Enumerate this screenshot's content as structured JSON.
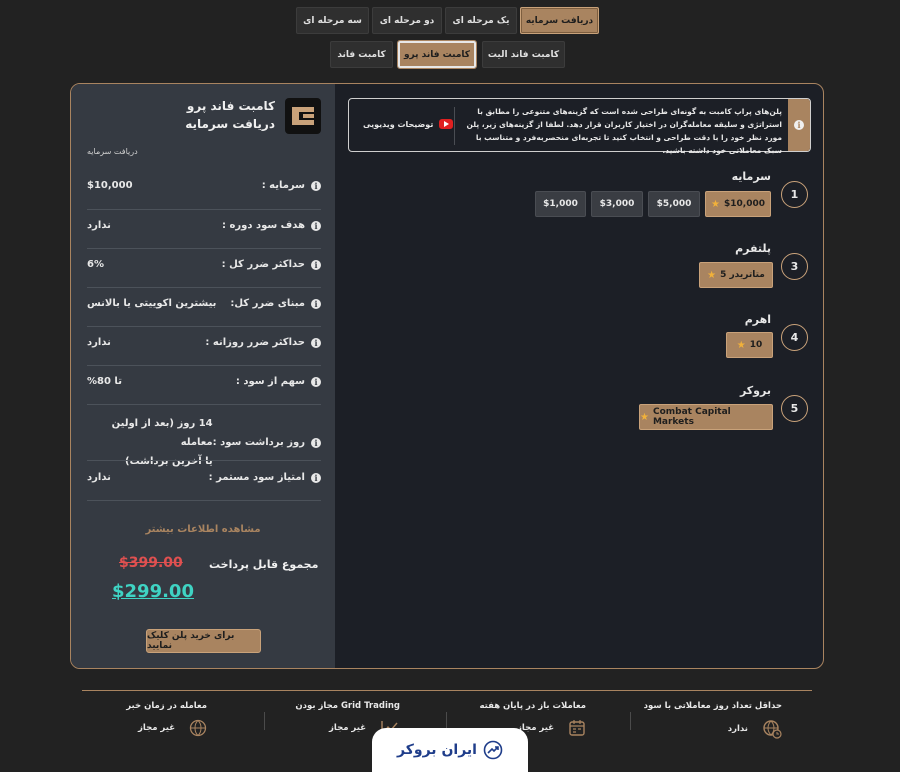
{
  "tabs_row1": [
    "دریافت سرمایه",
    "یک مرحله ای",
    "دو مرحله ای",
    "سه مرحله ای"
  ],
  "tabs_row2": [
    "کامبت فاند الیت",
    "کامبت فاند پرو",
    "کامبت فاند"
  ],
  "summary": {
    "plan_name": "کامبت فاند پرو",
    "plan_subtitle": "دریافت سرمایه",
    "breadcrumb": "دریافت سرمایه",
    "rows": [
      {
        "label": "سرمایه :",
        "value": "$10,000"
      },
      {
        "label": "هدف سود دوره :",
        "value": "ندارد"
      },
      {
        "label": "حداکثر ضرر کل :",
        "value": "6%"
      },
      {
        "label": "مبنای ضرر کل:",
        "value": "بیشترین اکوییتی یا بالانس"
      },
      {
        "label": "حداکثر ضرر روزانه :",
        "value": "ندارد"
      },
      {
        "label": "سهم از سود :",
        "value": "تا 80%"
      },
      {
        "label": "روز برداشت سود :",
        "value_line1": "14 روز (بعد از اولین معامله",
        "value_line2": "یا آخرین برداشت)"
      },
      {
        "label": "امتیاز سود مستمر :",
        "value": "ندارد"
      }
    ],
    "more_info": "مشاهده اطلاعات بیشتر",
    "total_label": "مجموع قابل پرداخت",
    "old_price": "$399.00",
    "new_price": "$299.00",
    "buy_button": "برای خرید پلن کلیک نمایید"
  },
  "notice": {
    "text": "پلن‌های پراپ کامبت به گونه‌ای طراحی شده است که گزینه‌های متنوعی را مطابق با استراتژی و سلیقه معامله‌گران در اختیار کاربران قرار دهد. لطفا از گزینه‌های زیر، پلن مورد نظر خود را با دقت طراحی و انتخاب کنید تا تجربه‌ای منحصربه‌فرد و متناسب با سبک معاملاتی خود داشته باشید.",
    "video_button": "توضیحات ویدیویی"
  },
  "steps": [
    {
      "number": "1",
      "title": "سرمایه",
      "options": [
        "$10,000",
        "$5,000",
        "$3,000",
        "$1,000"
      ],
      "selected": "$10,000"
    },
    {
      "number": "3",
      "title": "پلتفرم",
      "options": [
        "متاتریدر 5"
      ],
      "selected": "متاتریدر 5"
    },
    {
      "number": "4",
      "title": "اهرم",
      "options": [
        "10"
      ],
      "selected": "10"
    },
    {
      "number": "5",
      "title": "بروکر",
      "options": [
        "Combat Capital Markets"
      ],
      "selected": "Combat Capital Markets"
    }
  ],
  "bottom": [
    {
      "title": "حداقل تعداد روز معاملاتی با سود",
      "value": "ندارد",
      "icon": "clock-globe-icon"
    },
    {
      "title": "معاملات باز در پایان هفته",
      "value": "غیر مجاز",
      "icon": "calendar-icon"
    },
    {
      "title": "مجاز بودن Grid Trading",
      "value": "غیر مجاز",
      "icon": "chart-icon"
    },
    {
      "title": "معامله در زمان خبر",
      "value": "غیر مجاز",
      "icon": "globe-icon"
    }
  ],
  "watermark": "ایران بروکر",
  "colors": {
    "accent": "#a98460",
    "background": "#222222",
    "panel": "#353a42",
    "price_new": "#3fd3c3",
    "price_old": "#e05050",
    "star": "#f1b13a",
    "youtube": "#e02020"
  }
}
